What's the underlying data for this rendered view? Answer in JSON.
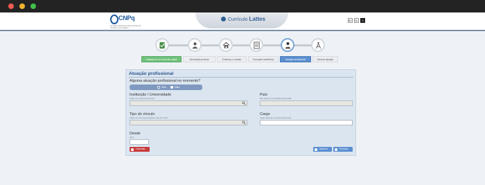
{
  "header": {
    "logo_text": "CNPq",
    "logo_subtitle": "Conselho Nacional de Desenvolvimento Científico e Tecnológico",
    "app_prefix": "Currículo",
    "app_name": "Lattes",
    "font_controls": [
      "A+",
      "A-",
      "◑"
    ]
  },
  "wizard": {
    "icons": [
      "document-check-icon",
      "person-icon",
      "house-icon",
      "book-icon",
      "person-tie-icon",
      "compass-icon"
    ],
    "steps": [
      {
        "label": "Cadastre-se no Currículo Lattes",
        "state": "done"
      },
      {
        "label": "Informação pessoal",
        "state": "pending"
      },
      {
        "label": "Endereço e contato",
        "state": "pending"
      },
      {
        "label": "Formação acadêmica",
        "state": "pending"
      },
      {
        "label": "Atuação profissional",
        "state": "current"
      },
      {
        "label": "Área de atuação",
        "state": "pending"
      }
    ]
  },
  "form": {
    "title": "Atuação profissional",
    "question": "Alguma atuação profissional no momento?",
    "radio_yes": "Sim",
    "radio_no": "Não",
    "selected": "Sim",
    "institution_label": "Instituição / Universidade",
    "institution_hint": "Clique no ícone para pesquisar",
    "institution_value": "",
    "country_label": "País",
    "country_hint": "País referente a instituição selecionada",
    "country_value": "",
    "bond_label": "Tipo do vínculo",
    "bond_hint": "Clique no ícone para pesquisar o tipo de vínculo",
    "bond_value": "",
    "role_label": "Cargo",
    "role_hint": "Cargo referente ao vínculo selecionado",
    "role_value": "",
    "since_label": "Desde",
    "since_hint": "(Ano)",
    "since_value": "",
    "cancel_label": "Cancelar",
    "prev_label": "Anterior",
    "next_label": "Próximo"
  },
  "colors": {
    "accent": "#2a548c",
    "done_step": "#6fc27a",
    "current_step": "#5b8fd0",
    "cancel": "#c83b3b"
  }
}
